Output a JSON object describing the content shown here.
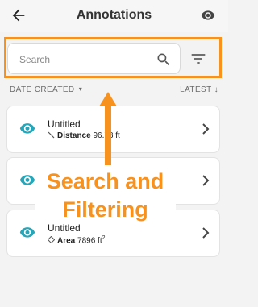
{
  "header": {
    "title": "Annotations",
    "back_icon": "arrow-left-icon",
    "visibility_icon": "eye-icon"
  },
  "search": {
    "placeholder": "Search",
    "value": "",
    "icon": "search-icon",
    "filter_icon": "filter-icon"
  },
  "sort": {
    "left_label": "DATE CREATED",
    "left_caret": "▾",
    "right_label": "LATEST",
    "right_arrow": "↓"
  },
  "items": [
    {
      "name": "Untitled",
      "metric_icon": "line-measure-icon",
      "metric_label": "Distance",
      "metric_value": "96.78 ft"
    },
    {
      "name": "",
      "metric_icon": "",
      "metric_label": "",
      "metric_value": ""
    },
    {
      "name": "Untitled",
      "metric_icon": "area-measure-icon",
      "metric_label": "Area",
      "metric_value": "7896 ft",
      "metric_superscript": "2"
    }
  ],
  "callout": {
    "line1": "Search and",
    "line2": "Filtering"
  },
  "colors": {
    "accent": "#f7921e",
    "teal": "#26a6b8",
    "background": "#f3f3f3"
  }
}
